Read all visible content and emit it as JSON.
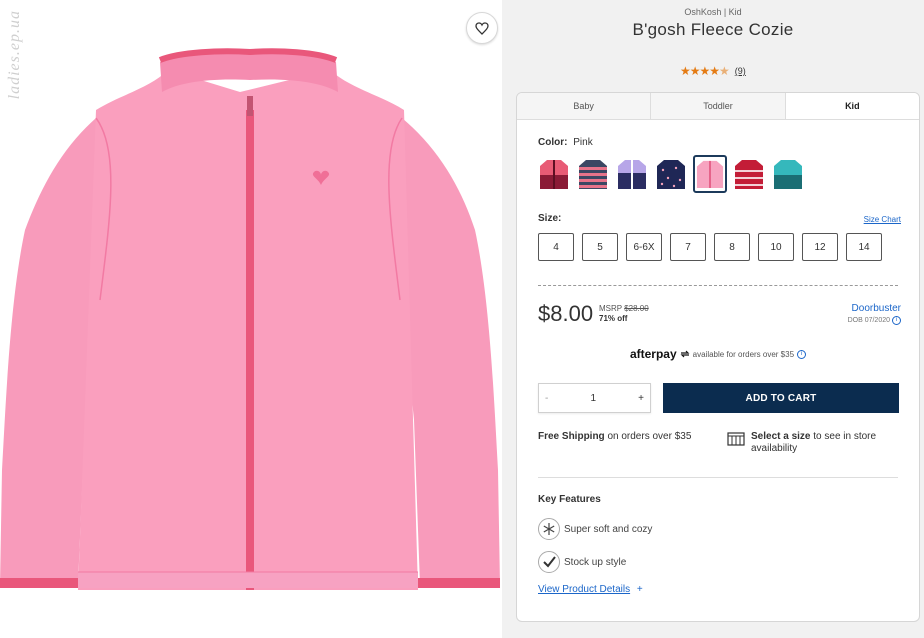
{
  "watermark": "ladies.ep.ua",
  "brand_line": "OshKosh | Kid",
  "product_title": "B'gosh Fleece Cozie",
  "rating": {
    "stars": 4.5,
    "count_text": "(9)"
  },
  "tabs": [
    {
      "label": "Baby",
      "active": false
    },
    {
      "label": "Toddler",
      "active": false
    },
    {
      "label": "Kid",
      "active": true
    }
  ],
  "color": {
    "label": "Color:",
    "value": "Pink"
  },
  "swatches": [
    {
      "name": "raspberry",
      "main": "#e85b75",
      "accent": "#8b1b36",
      "selected": false
    },
    {
      "name": "stripe",
      "main": "#3b4763",
      "accent": "#e6738a",
      "selected": false
    },
    {
      "name": "lavender",
      "main": "#b7a6e8",
      "accent": "#2b2d62",
      "selected": false
    },
    {
      "name": "navy-print",
      "main": "#1f2756",
      "accent": "#f3a1b9",
      "selected": false
    },
    {
      "name": "pink",
      "main": "#f7a4c0",
      "accent": "#e55f87",
      "selected": true
    },
    {
      "name": "red-print",
      "main": "#c31d37",
      "accent": "#ffffff",
      "selected": false
    },
    {
      "name": "teal",
      "main": "#35b8bc",
      "accent": "#1b6e74",
      "selected": false
    }
  ],
  "size": {
    "label": "Size:",
    "chart_link": "Size Chart",
    "options": [
      "4",
      "5",
      "6-6X",
      "7",
      "8",
      "10",
      "12",
      "14"
    ]
  },
  "price": {
    "current": "$8.00",
    "msrp_label": "MSRP",
    "msrp_value": "$28.00",
    "discount": "71% off",
    "promo_label": "Doorbuster",
    "promo_date": "DOB 07/2020"
  },
  "afterpay": {
    "logo": "afterpay",
    "text": "available for orders over $35"
  },
  "quantity": {
    "minus": "-",
    "value": "1",
    "plus": "+"
  },
  "add_to_cart": "ADD TO CART",
  "shipping": {
    "bold": "Free Shipping",
    "text": "on orders over $35"
  },
  "store": {
    "bold": "Select a size",
    "text": "to see in store availability"
  },
  "features": {
    "title": "Key Features",
    "items": [
      {
        "label": "Super soft and cozy",
        "icon": "snowflake-icon"
      },
      {
        "label": "Stock up style",
        "icon": "checkmark-icon"
      }
    ],
    "details_link": "View Product Details",
    "details_plus": "+"
  },
  "colors": {
    "accent_blue": "#1b66c9",
    "cart_navy": "#0b2c4f",
    "star_orange": "#e47b14",
    "jacket_pink": "#fa9fbe"
  }
}
